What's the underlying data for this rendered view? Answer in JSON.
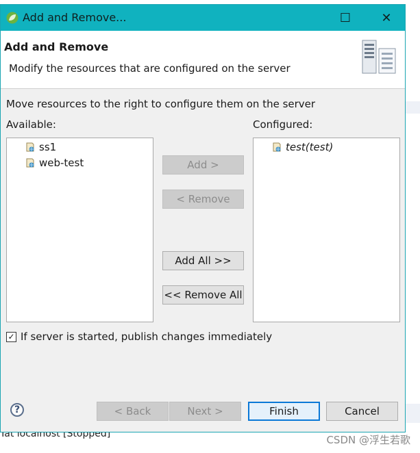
{
  "window": {
    "title": "Add and Remove...",
    "maximize_glyph": "☐",
    "close_glyph": "✕"
  },
  "header": {
    "title": "Add and Remove",
    "description": "Modify the resources that are configured on the server"
  },
  "instruction": "Move resources to the right to configure them on the server",
  "available": {
    "label": "Available:",
    "items": [
      "ss1",
      "web-test"
    ]
  },
  "configured": {
    "label": "Configured:",
    "items": [
      "test(test)"
    ]
  },
  "buttons": {
    "add": "Add >",
    "remove": "< Remove",
    "add_all": "Add All >>",
    "remove_all": "<< Remove All"
  },
  "publish_option": {
    "label": "If server is started, publish changes immediately",
    "checked": true
  },
  "footer": {
    "help": "?",
    "back": "< Back",
    "next": "Next >",
    "finish": "Finish",
    "cancel": "Cancel"
  },
  "background": {
    "status_text": "Tat localhost  [Stopped]",
    "watermark": "CSDN @浮生若歌"
  },
  "colors": {
    "titlebar": "#10b2bf",
    "default_button_border": "#0a78d7"
  }
}
